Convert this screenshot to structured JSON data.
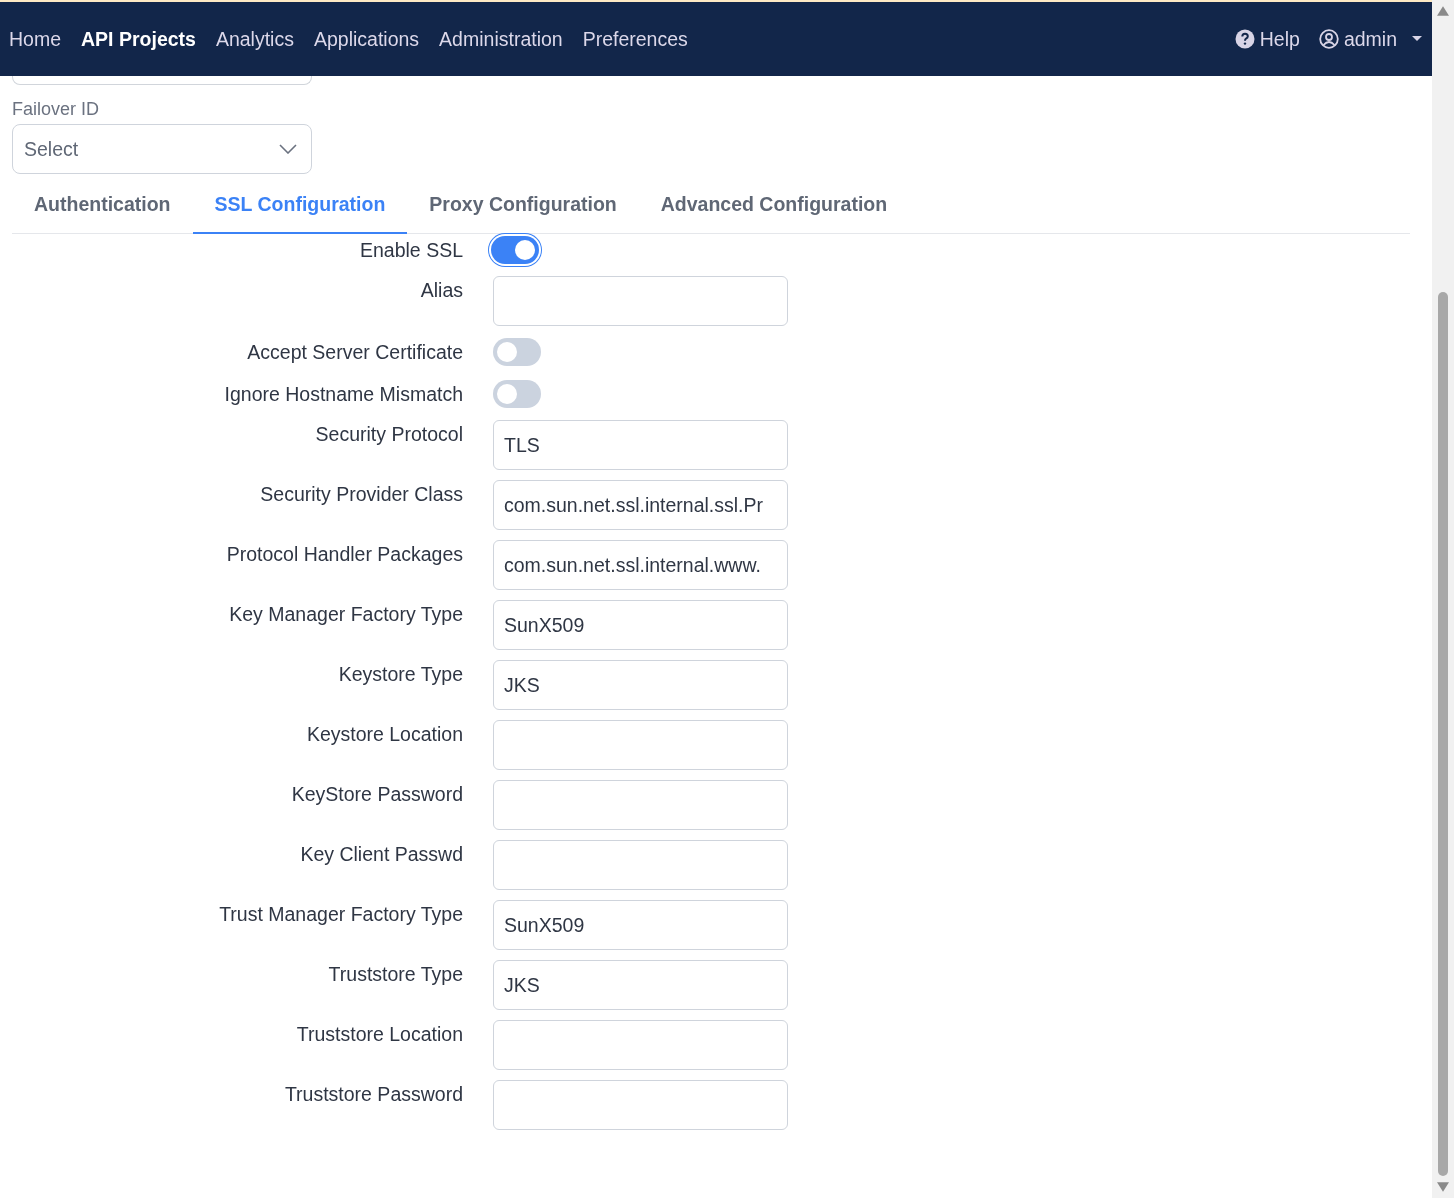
{
  "nav": {
    "items": [
      {
        "label": "Home",
        "selected": false
      },
      {
        "label": "API Projects",
        "selected": true
      },
      {
        "label": "Analytics",
        "selected": false
      },
      {
        "label": "Applications",
        "selected": false
      },
      {
        "label": "Administration",
        "selected": false
      },
      {
        "label": "Preferences",
        "selected": false
      }
    ],
    "help": "Help",
    "user": "admin"
  },
  "failover": {
    "label": "Failover ID",
    "placeholder": "Select"
  },
  "tabs": [
    {
      "label": "Authentication",
      "selected": false
    },
    {
      "label": "SSL Configuration",
      "selected": true
    },
    {
      "label": "Proxy Configuration",
      "selected": false
    },
    {
      "label": "Advanced Configuration",
      "selected": false
    }
  ],
  "fields": [
    {
      "kind": "toggle",
      "label": "Enable SSL",
      "on": true
    },
    {
      "kind": "text",
      "label": "Alias"
    },
    {
      "kind": "toggle",
      "label": "Accept Server Certificate",
      "on": false
    },
    {
      "kind": "toggle",
      "label": "Ignore Hostname Mismatch",
      "on": false
    },
    {
      "kind": "text",
      "label": "Security Protocol",
      "value": "TLS"
    },
    {
      "kind": "text",
      "label": "Security Provider Class",
      "value": "com.sun.net.ssl.internal.ssl.Pr"
    },
    {
      "kind": "text",
      "label": "Protocol Handler Packages",
      "value": "com.sun.net.ssl.internal.www."
    },
    {
      "kind": "text",
      "label": "Key Manager Factory Type",
      "value": "SunX509"
    },
    {
      "kind": "text",
      "label": "Keystore Type",
      "value": "JKS"
    },
    {
      "kind": "text",
      "label": "Keystore Location"
    },
    {
      "kind": "text",
      "label": "KeyStore Password"
    },
    {
      "kind": "text",
      "label": "Key Client Passwd"
    },
    {
      "kind": "text",
      "label": "Trust Manager Factory Type",
      "value": "SunX509"
    },
    {
      "kind": "text",
      "label": "Truststore Type",
      "value": "JKS"
    },
    {
      "kind": "text",
      "label": "Truststore Location"
    },
    {
      "kind": "text",
      "label": "Truststore Password"
    }
  ]
}
